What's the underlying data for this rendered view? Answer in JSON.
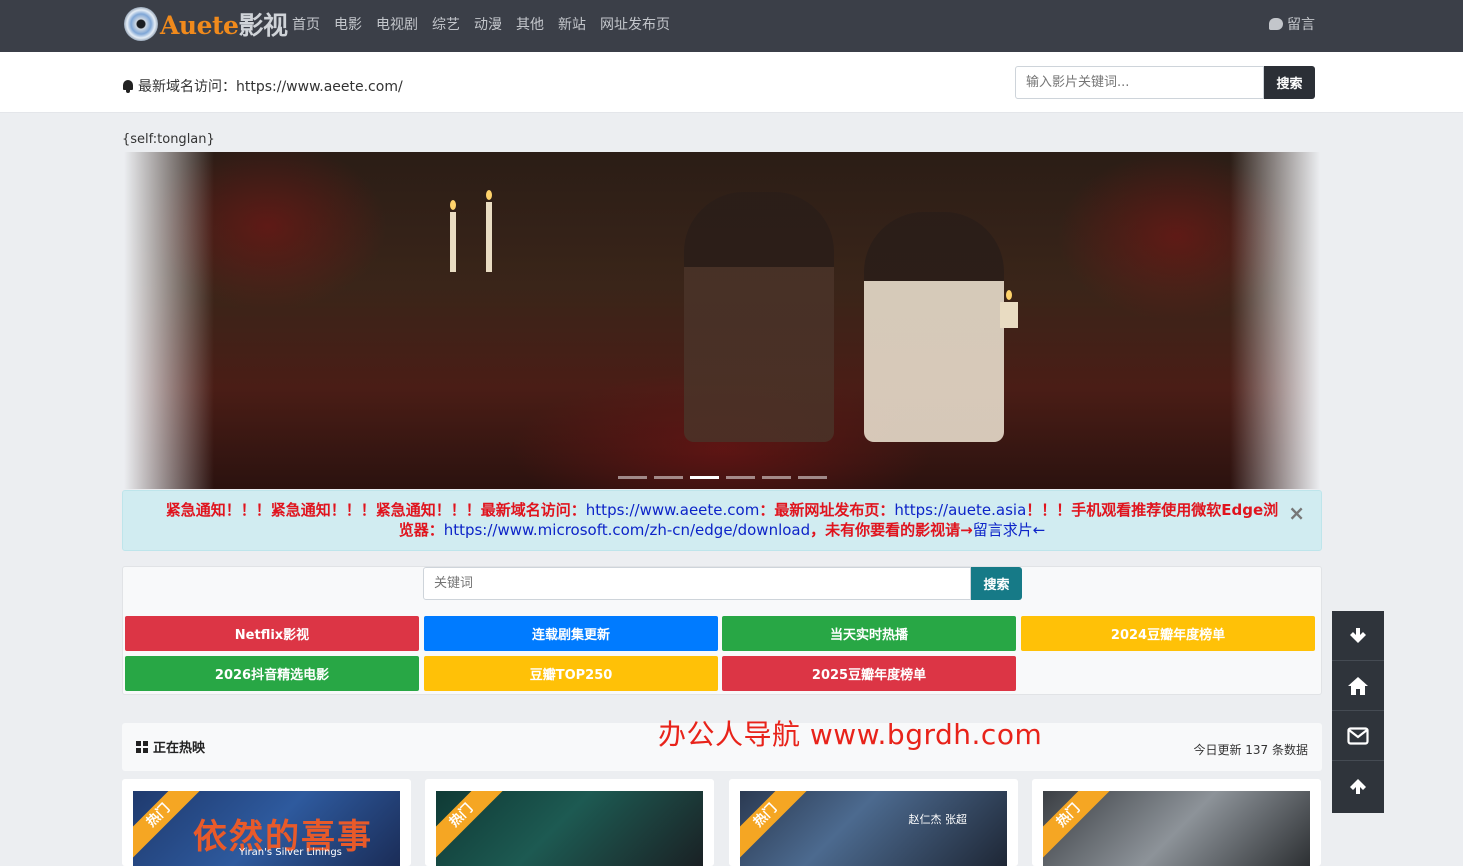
{
  "brand": {
    "name_en": "Auete",
    "name_cn": "影视"
  },
  "nav": {
    "items": [
      "首页",
      "电影",
      "电视剧",
      "综艺",
      "动漫",
      "其他",
      "新站",
      "网址发布页"
    ],
    "message": "留言"
  },
  "subbar": {
    "notice": "最新域名访问：https://www.aeete.com/",
    "search_placeholder": "输入影片关键词...",
    "search_button": "搜索"
  },
  "tag_text": "{self:tonglan}",
  "banner": {
    "slides": 6,
    "active_slide": 3
  },
  "alert": {
    "part1": "紧急通知！！！紧急通知！！！紧急通知！！！最新域名访问：",
    "link1": "https://www.aeete.com",
    "part2": "：最新网址发布页：",
    "link2": "https://auete.asia",
    "part3": "！！！手机观看推荐使用微软Edge浏览器：",
    "link3": "https://www.microsoft.com/zh-cn/edge/download",
    "part4": "，未有你要看的影视请→",
    "link4": "留言求片←",
    "close": "×"
  },
  "quick": {
    "search_placeholder": "关键词",
    "search_button": "搜索",
    "buttons": [
      "Netflix影视",
      "连载剧集更新",
      "当天实时热播",
      "2024豆瓣年度榜单",
      "2026抖音精选电影",
      "豆瓣TOP250",
      "2025豆瓣年度榜单"
    ]
  },
  "section": {
    "title": "正在热映",
    "count": "今日更新 137 条数据"
  },
  "watermark": "办公人导航 www.bgrdh.com",
  "cards": [
    {
      "badge": "热门",
      "poster_title": "依然的喜事",
      "poster_sub": "Yiran's Silver Linings"
    },
    {
      "badge": "热门"
    },
    {
      "badge": "热门",
      "poster_sub": "赵仁杰 张超"
    },
    {
      "badge": "热门"
    }
  ],
  "sidetools": [
    "arrow-down-icon",
    "home-icon",
    "mail-icon",
    "arrow-up-icon"
  ]
}
